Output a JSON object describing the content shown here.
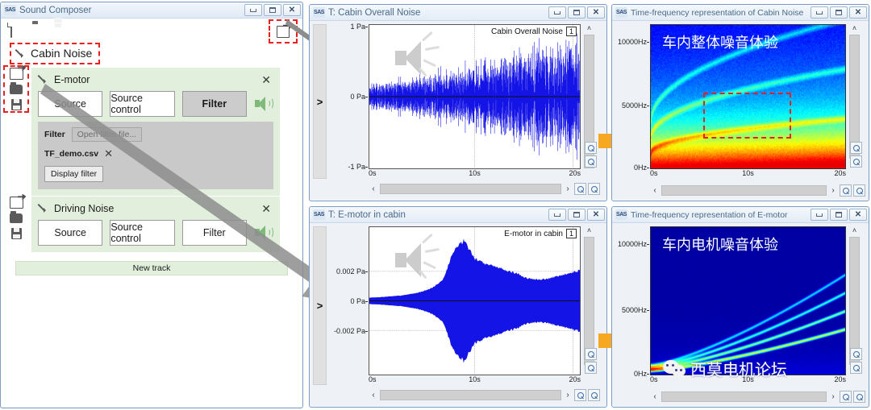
{
  "composer": {
    "title": "Sound Composer",
    "logo": "SAS",
    "toolbar": {
      "new": "new-file-icon",
      "open": "open-folder-icon",
      "save": "save-icon",
      "export": "export-icon"
    },
    "window_buttons": {
      "minimize": "minimize-icon",
      "maximize": "maximize-icon",
      "close": "close-icon"
    },
    "project_name": "Cabin Noise",
    "tracks": [
      {
        "name": "E-motor",
        "buttons": [
          "Source",
          "Source control",
          "Filter"
        ],
        "active_button": "Filter",
        "close": "✕",
        "filter_panel": {
          "label": "Filter",
          "open_button": "Open filter file...",
          "file_name": "TF_demo.csv",
          "file_remove": "✕",
          "display_button": "Display filter"
        }
      },
      {
        "name": "Driving Noise",
        "buttons": [
          "Source",
          "Source control",
          "Filter"
        ],
        "active_button": "",
        "close": "✕"
      }
    ],
    "new_track_label": "New track"
  },
  "windows": [
    {
      "id": "cabin-overall-noise",
      "title": "T: Cabin Overall Noise",
      "logo": "SAS",
      "expander": ">",
      "series_label": "Cabin Overall Noise",
      "series_number": "1",
      "scroll_left": "‹",
      "scroll_right": "›",
      "scroll_up": "˄",
      "scroll_down": "˅"
    },
    {
      "id": "emotor-in-cabin",
      "title": "T: E-motor in cabin",
      "logo": "SAS",
      "expander": ">",
      "series_label": "E-motor in cabin",
      "series_number": "1",
      "scroll_left": "‹",
      "scroll_right": "›",
      "scroll_up": "˄",
      "scroll_down": "˅"
    },
    {
      "id": "tf-cabin-noise",
      "title": "Time-frequency representation of Cabin Noise",
      "logo": "SAS",
      "overlay_text": "车内整体噪音体验",
      "scroll_left": "‹",
      "scroll_right": "›",
      "scroll_up": "˄",
      "scroll_down": "˅"
    },
    {
      "id": "tf-emotor",
      "title": "Time-frequency representation of E-motor",
      "logo": "SAS",
      "overlay_text": "车内电机噪音体验",
      "scroll_left": "‹",
      "scroll_right": "›",
      "scroll_up": "˄",
      "scroll_down": "˅"
    }
  ],
  "watermark": {
    "text": "西莫电机论坛",
    "logo": "wechat-icon"
  },
  "colors": {
    "accent_orange": "#f6a821",
    "highlight_red": "#e8201e",
    "waveform_blue": "#1414e6",
    "track_green": "#e2efdc",
    "title_blue": "#4a6a8a"
  },
  "chart_data": [
    {
      "type": "line",
      "id": "cabin-overall-noise",
      "title": "Cabin Overall Noise",
      "xlabel": "",
      "ylabel": "",
      "xticks": [
        "0s",
        "10s",
        "20s"
      ],
      "yticks": [
        "1 Pa",
        "0 Pa",
        "-1 Pa"
      ],
      "xlim": [
        0,
        20
      ],
      "ylim": [
        -1,
        1
      ],
      "grid": true,
      "description": "Broadband random noise waveform, amplitude envelope growing from about 0.2 Pa near 0s to about 0.9 Pa near 20s, symmetric about 0 Pa.",
      "envelope": [
        0.18,
        0.2,
        0.22,
        0.25,
        0.28,
        0.3,
        0.33,
        0.38,
        0.42,
        0.45,
        0.5,
        0.55,
        0.58,
        0.62,
        0.66,
        0.7,
        0.74,
        0.78,
        0.82,
        0.86,
        0.9
      ]
    },
    {
      "type": "area",
      "id": "emotor-in-cabin",
      "title": "E-motor in cabin",
      "xlabel": "",
      "ylabel": "",
      "xticks": [
        "0s",
        "10s",
        "20s"
      ],
      "yticks": [
        "0.002 Pa",
        "0 Pa",
        "-0.002 Pa"
      ],
      "xlim": [
        0,
        20
      ],
      "ylim": [
        -0.0028,
        0.0028
      ],
      "grid": true,
      "description": "E-motor tonal run-up waveform; envelope rises to a sharp peak of about 0.0023 Pa at 8.5s, decays to about 0.0008 Pa at 16s, then rises slightly to 0.0011 Pa at 20s.",
      "envelope": [
        0.00012,
        0.00014,
        0.00017,
        0.0002,
        0.00026,
        0.00035,
        0.0005,
        0.0008,
        0.0019,
        0.0023,
        0.0016,
        0.0014,
        0.0013,
        0.00115,
        0.00105,
        0.00085,
        0.0008,
        0.00085,
        0.00095,
        0.00105,
        0.00115
      ]
    },
    {
      "type": "heatmap",
      "id": "tf-cabin-noise",
      "title": "Time-frequency representation of Cabin Noise",
      "xlabel": "",
      "ylabel": "",
      "xticks": [
        "0s",
        "10s",
        "20s"
      ],
      "yticks": [
        "10000Hz",
        "5000Hz",
        "0Hz"
      ],
      "xlim": [
        0,
        20
      ],
      "ylim": [
        0,
        10000
      ],
      "colormap": "jet",
      "description": "Spectrogram of cabin noise: strong red/orange broadband energy below ~1000Hz, cyan/green band up to ~2500Hz, dark blue above 6000Hz, with faint rising order lines between 3000Hz and 7000Hz highlighted by a red dashed selection box spanning roughly 6s-16s and 4500Hz-7500Hz."
    },
    {
      "type": "heatmap",
      "id": "tf-emotor",
      "title": "Time-frequency representation of E-motor",
      "xlabel": "",
      "ylabel": "",
      "xticks": [
        "0s",
        "10s",
        "20s"
      ],
      "yticks": [
        "10000Hz",
        "5000Hz",
        "0Hz"
      ],
      "xlim": [
        0,
        20
      ],
      "ylim": [
        0,
        10000
      ],
      "colormap": "jet",
      "description": "Spectrogram of the E-motor source: dark blue background with four bright cyan/green rising order curves starting near 0Hz at 0s and reaching 3000-6500Hz by 20s."
    }
  ]
}
